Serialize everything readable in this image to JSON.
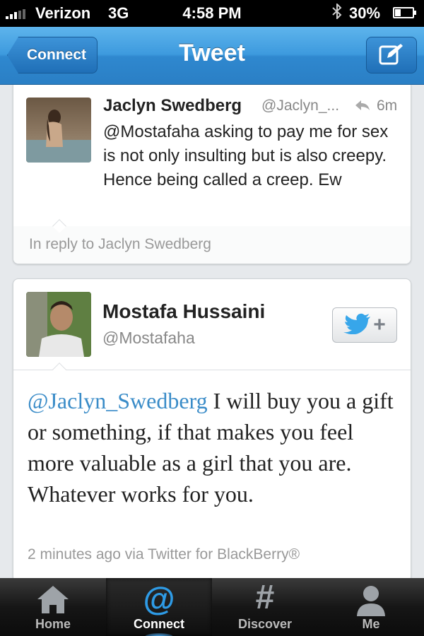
{
  "status_bar": {
    "carrier": "Verizon",
    "network": "3G",
    "time": "4:58 PM",
    "battery_percent": "30%",
    "battery_level": 0.3,
    "bluetooth_icon": "bluetooth-icon"
  },
  "nav": {
    "back_label": "Connect",
    "title": "Tweet",
    "compose_icon": "compose-icon"
  },
  "tweets": {
    "replied": {
      "name": "Jaclyn Swedberg",
      "handle": "@Jaclyn_...",
      "time": "6m",
      "text": "@Mostafaha asking to pay me for sex is not only insulting but is also creepy. Hence being called a creep. Ew",
      "reply_context": "In reply to Jaclyn Swedberg"
    },
    "main": {
      "name": "Mostafa Hussaini",
      "handle": "@Mostafaha",
      "follow_icon": "follow-bird-icon",
      "mention": "@Jaclyn_Swedberg",
      "text": " I will buy you a gift or something, if that makes you feel more valuable as a girl that you are. Whatever works for you.",
      "meta": "2 minutes ago via Twitter for BlackBerry®"
    }
  },
  "tab_bar": {
    "items": [
      {
        "label": "Home",
        "icon": "home-icon",
        "active": false
      },
      {
        "label": "Connect",
        "icon": "at-icon",
        "active": true
      },
      {
        "label": "Discover",
        "icon": "hash-icon",
        "active": false
      },
      {
        "label": "Me",
        "icon": "person-icon",
        "active": false
      }
    ]
  },
  "colors": {
    "nav_blue": "#3d9ade",
    "mention_blue": "#3a8cc8",
    "active_tab_icon": "#2e9be6"
  }
}
